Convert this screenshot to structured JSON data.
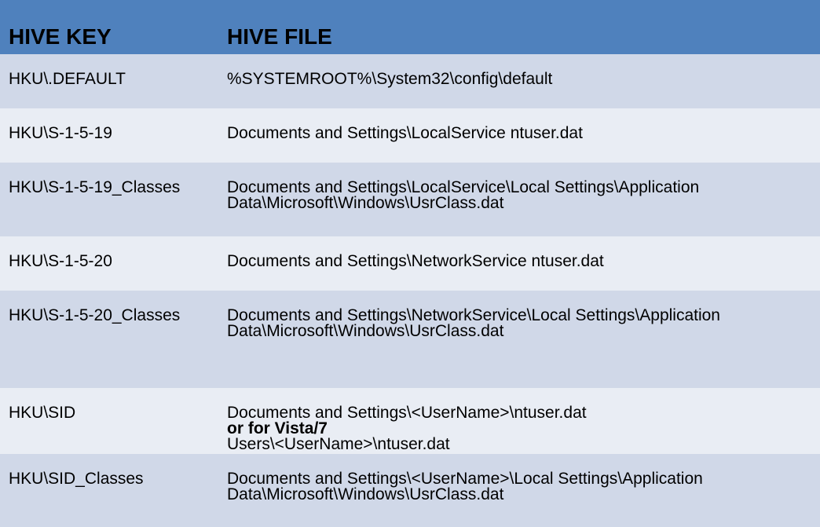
{
  "header": {
    "key_label": "HIVE KEY",
    "file_label": "HIVE FILE"
  },
  "rows": [
    {
      "key": "HKU\\.DEFAULT",
      "file": [
        "%SYSTEMROOT%\\System32\\config\\default"
      ]
    },
    {
      "key": "HKU\\S-1-5-19",
      "file": [
        "Documents and Settings\\LocalService ntuser.dat"
      ]
    },
    {
      "key": "HKU\\S-1-5-19_Classes",
      "file": [
        "Documents and Settings\\LocalService\\Local Settings\\Application",
        "Data\\Microsoft\\Windows\\UsrClass.dat"
      ]
    },
    {
      "key": "HKU\\S-1-5-20",
      "file": [
        "Documents and Settings\\NetworkService ntuser.dat"
      ]
    },
    {
      "key": "HKU\\S-1-5-20_Classes",
      "file": [
        "Documents and Settings\\NetworkService\\Local Settings\\Application",
        "Data\\Microsoft\\Windows\\UsrClass.dat"
      ]
    },
    {
      "key": "HKU\\SID",
      "file": [
        "Documents and Settings\\<UserName>\\ntuser.dat",
        "or for Vista/7",
        "Users\\<UserName>\\ntuser.dat"
      ]
    },
    {
      "key": "HKU\\SID_Classes",
      "file": [
        "Documents and Settings\\<UserName>\\Local Settings\\Application",
        "Data\\Microsoft\\Windows\\UsrClass.dat"
      ]
    }
  ],
  "colors": {
    "header_bg": "#4f81bd",
    "row_dark": "#d0d8e8",
    "row_light": "#e9edf4"
  }
}
